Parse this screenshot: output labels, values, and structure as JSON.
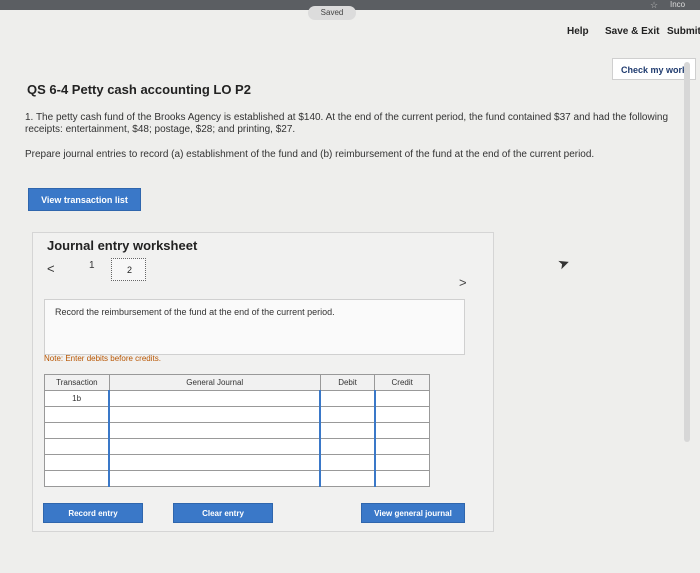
{
  "header": {
    "saved": "Saved",
    "top_right": "Inco",
    "help": "Help",
    "save_exit": "Save & Exit",
    "submit": "Submit",
    "check_work": "Check my work"
  },
  "page_title": "QS 6-4 Petty cash accounting LO P2",
  "question": {
    "text": "1. The petty cash fund of the Brooks Agency is established at $140. At the end of the current period, the fund contained $37 and had the following receipts: entertainment, $48; postage, $28; and printing, $27.",
    "prompt": "Prepare journal entries to record (a) establishment of the fund and (b) reimbursement of the fund at the end of the current period."
  },
  "view_transaction_list": "View transaction list",
  "worksheet": {
    "title": "Journal entry worksheet",
    "pages": [
      "1",
      "2"
    ],
    "active_page": "2",
    "instruction": "Record the reimbursement of the fund at the end of the current period.",
    "note": "Note: Enter debits before credits.",
    "columns": [
      "Transaction",
      "General Journal",
      "Debit",
      "Credit"
    ],
    "rows": [
      {
        "transaction": "1b",
        "account": "",
        "debit": "",
        "credit": ""
      },
      {
        "transaction": "",
        "account": "",
        "debit": "",
        "credit": ""
      },
      {
        "transaction": "",
        "account": "",
        "debit": "",
        "credit": ""
      },
      {
        "transaction": "",
        "account": "",
        "debit": "",
        "credit": ""
      },
      {
        "transaction": "",
        "account": "",
        "debit": "",
        "credit": ""
      },
      {
        "transaction": "",
        "account": "",
        "debit": "",
        "credit": ""
      }
    ],
    "record_entry": "Record entry",
    "clear_entry": "Clear entry",
    "view_general_journal": "View general journal"
  }
}
